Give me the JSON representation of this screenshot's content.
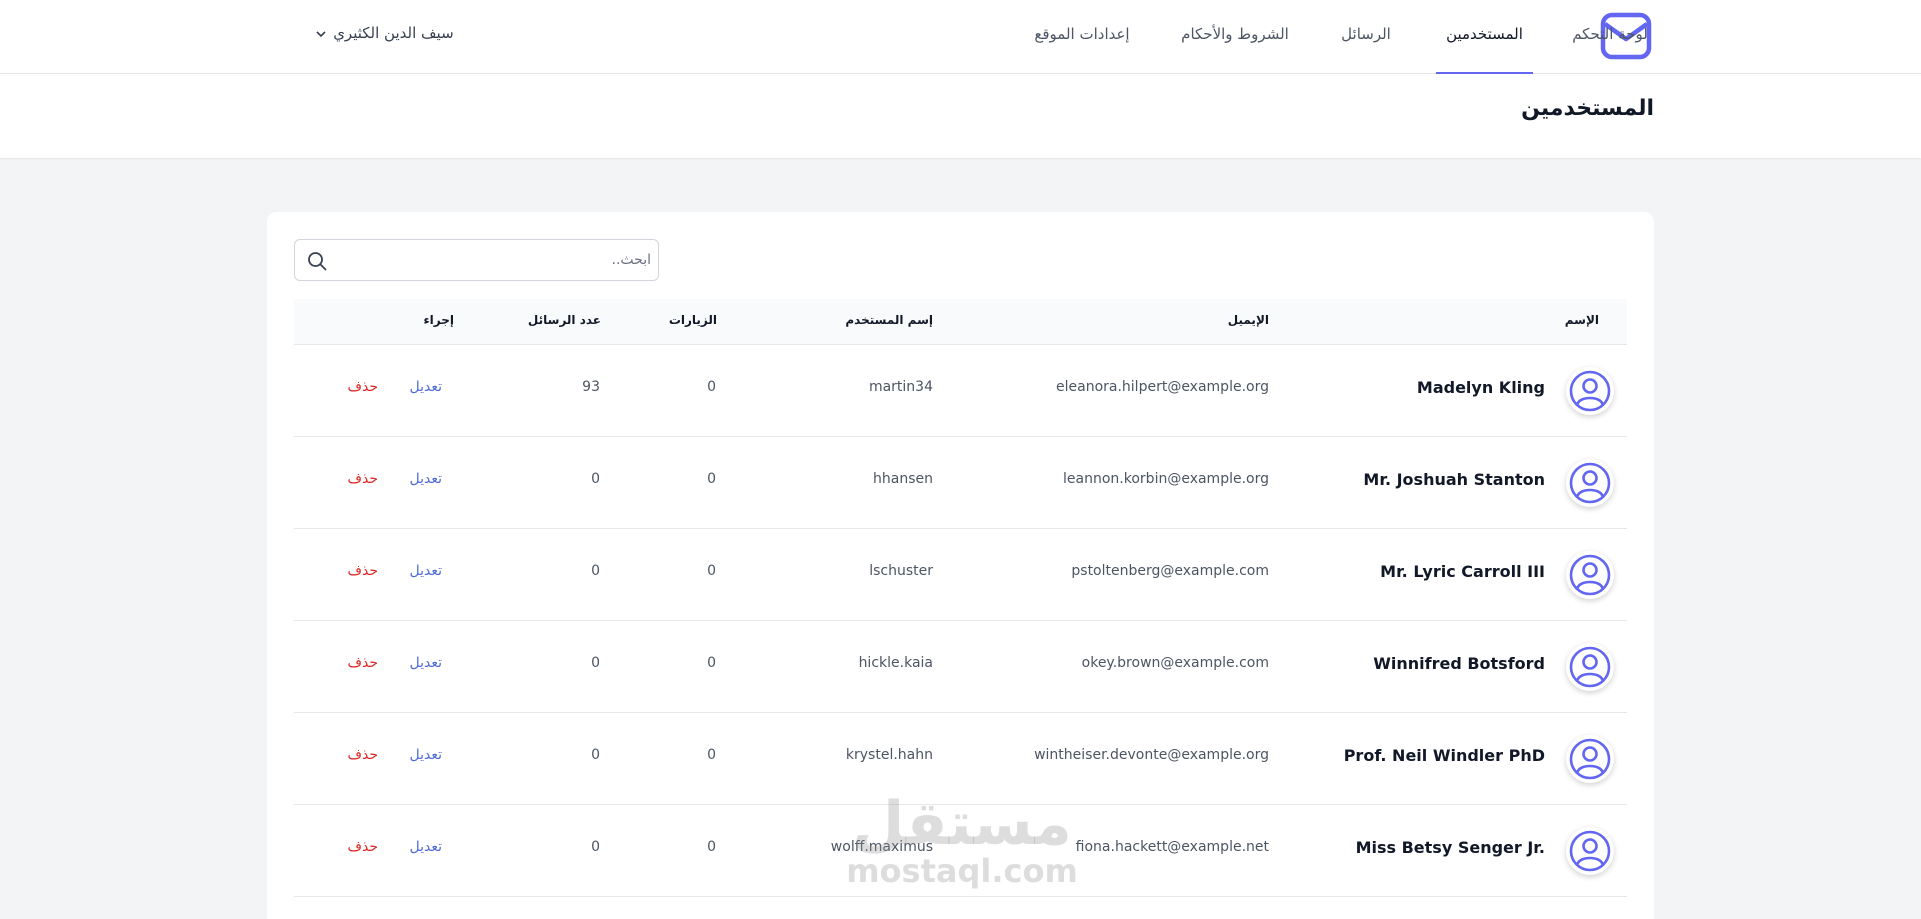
{
  "brand": {
    "logo_icon": "mail-icon",
    "accent": "#6366f1"
  },
  "nav": {
    "items": [
      {
        "label": "لوحة التحكم",
        "active": false
      },
      {
        "label": "المستخدمين",
        "active": true
      },
      {
        "label": "الرسائل",
        "active": false
      },
      {
        "label": "الشروط والأحكام",
        "active": false
      },
      {
        "label": "إعدادات الموقع",
        "active": false
      }
    ]
  },
  "user_menu": {
    "name": "سيف الدين الكثيري",
    "icon": "chevron-down-icon"
  },
  "header": {
    "title": "المستخدمين"
  },
  "search": {
    "placeholder": "ابحث..",
    "value": ""
  },
  "table": {
    "columns": [
      "الإسم",
      "الإيميل",
      "إسم المستخدم",
      "الزيارات",
      "عدد الرسائل",
      "إجراء"
    ],
    "actions": {
      "edit": "تعديل",
      "delete": "حذف"
    },
    "rows": [
      {
        "name": "Madelyn Kling",
        "email": "eleanora.hilpert@example.org",
        "username": "martin34",
        "visits": "0",
        "messages": "93"
      },
      {
        "name": "Mr. Joshuah Stanton",
        "email": "leannon.korbin@example.org",
        "username": "hhansen",
        "visits": "0",
        "messages": "0"
      },
      {
        "name": "Mr. Lyric Carroll III",
        "email": "pstoltenberg@example.com",
        "username": "lschuster",
        "visits": "0",
        "messages": "0"
      },
      {
        "name": "Winnifred Botsford",
        "email": "okey.brown@example.com",
        "username": "hickle.kaia",
        "visits": "0",
        "messages": "0"
      },
      {
        "name": "Prof. Neil Windler PhD",
        "email": "wintheiser.devonte@example.org",
        "username": "krystel.hahn",
        "visits": "0",
        "messages": "0"
      },
      {
        "name": "Miss Betsy Senger Jr.",
        "email": "fiona.hackett@example.net",
        "username": "wolff.maximus",
        "visits": "0",
        "messages": "0"
      }
    ]
  },
  "watermark": {
    "arabic": "مستقل",
    "latin": "mostaql.com"
  }
}
